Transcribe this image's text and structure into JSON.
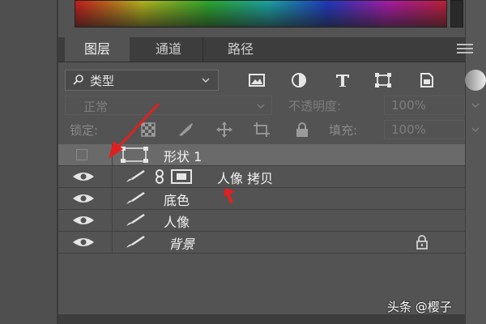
{
  "tabs": {
    "layers": "图层",
    "channels": "通道",
    "paths": "路径"
  },
  "filter": {
    "label": "类型",
    "icons": [
      "image-filter-icon",
      "adjustment-filter-icon",
      "type-filter-icon",
      "shape-filter-icon",
      "smart-object-filter-icon"
    ]
  },
  "blend": {
    "mode": "正常",
    "opacity_label": "不透明度:",
    "opacity_value": "100%"
  },
  "lock": {
    "label": "锁定:",
    "fill_label": "填充:",
    "fill_value": "100%",
    "icons": [
      "lock-transparent-icon",
      "lock-image-icon",
      "lock-position-icon",
      "lock-artboard-icon",
      "lock-all-icon"
    ]
  },
  "layers": [
    {
      "name": "形状 1",
      "visible": false,
      "selected": true,
      "type": "shape"
    },
    {
      "name": "人像 拷贝",
      "visible": true,
      "selected": false,
      "type": "masked"
    },
    {
      "name": "底色",
      "visible": true,
      "selected": false,
      "type": "pixel"
    },
    {
      "name": "人像",
      "visible": true,
      "selected": false,
      "type": "pixel"
    },
    {
      "name": "背景",
      "visible": true,
      "selected": false,
      "type": "background",
      "locked": true
    }
  ],
  "watermark": "头条 @樱子",
  "colors": {
    "panel_bg": "#535353",
    "tab_bar": "#3d3d3d",
    "selected_row": "#6a6a6a",
    "annotation": "#e02020"
  }
}
